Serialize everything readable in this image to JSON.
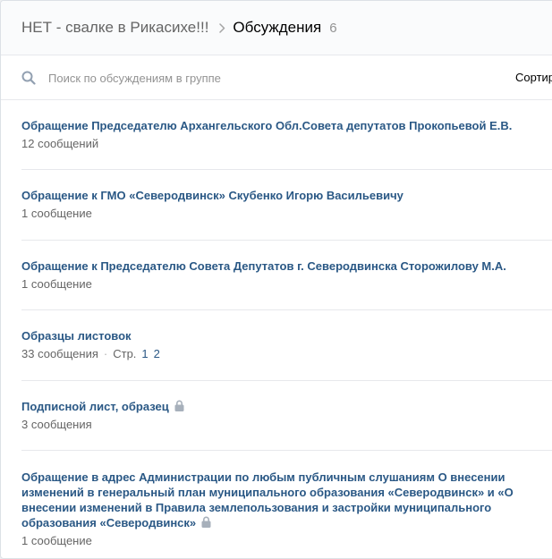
{
  "header": {
    "group_name": "НЕТ - свалке в Рикасихе!!!",
    "section": "Обсуждения",
    "count": "6"
  },
  "search": {
    "placeholder": "Поиск по обсуждениям в группе",
    "value": "",
    "sort_label": "Сортир"
  },
  "topics": [
    {
      "title": "Обращение Председателю Архангельского Обл.Совета депутатов Прокопьевой Е.В.",
      "posts": "12 сообщений",
      "locked": false
    },
    {
      "title": "Обращение к ГМО «Северодвинск» Скубенко Игорю Васильевичу",
      "posts": "1 сообщение",
      "locked": false
    },
    {
      "title": "Обращение к Председателю Совета Депутатов г. Северодвинска Сторожилову М.А.",
      "posts": "1 сообщение",
      "locked": false
    },
    {
      "title": "Образцы листовок",
      "posts": "33 сообщения",
      "pages_label": "Стр.",
      "pages": [
        "1",
        "2"
      ],
      "locked": false
    },
    {
      "title": "Подписной лист, образец",
      "posts": "3 сообщения",
      "locked": true
    },
    {
      "title": "Обращение в адрес Администрации по любым публичным слушаниям О внесении изменений в генеральный план муниципального образования «Северодвинск» и «О внесении изменений в Правила землепользования и застройки муниципального образования «Северодвинск»",
      "posts": "1 сообщение",
      "locked": true
    }
  ],
  "colors": {
    "link": "#2a5885",
    "meta": "#656565",
    "header_bg": "#fafbfc",
    "divider": "#e7e8ec"
  },
  "icons": {
    "search": "search-icon",
    "separator": "chevron-right-icon",
    "lock": "lock-icon"
  }
}
